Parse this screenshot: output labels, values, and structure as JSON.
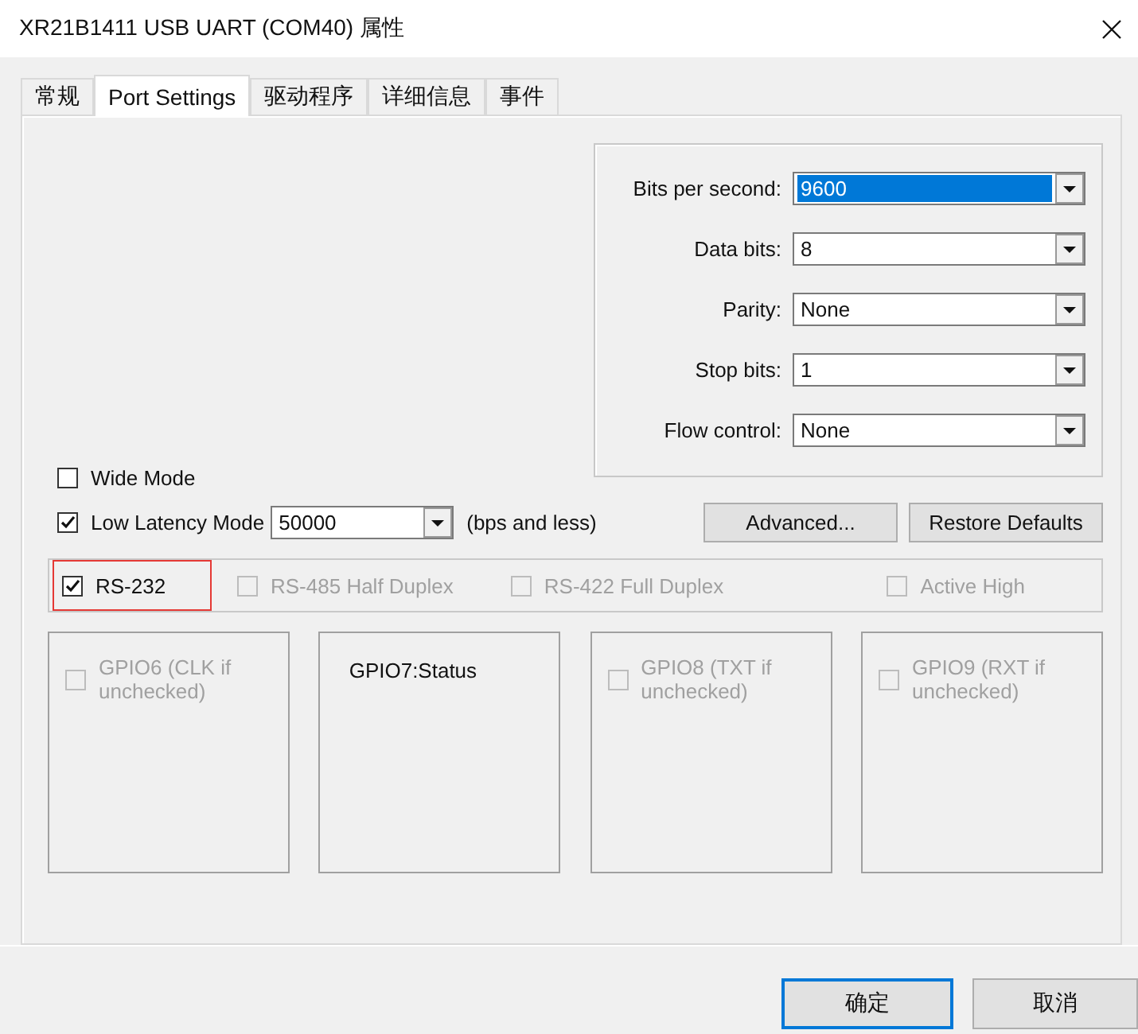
{
  "window": {
    "title": "XR21B1411 USB UART (COM40) 属性"
  },
  "tabs": [
    {
      "label": "常规",
      "selected": false
    },
    {
      "label": "Port Settings",
      "selected": true
    },
    {
      "label": "驱动程序",
      "selected": false
    },
    {
      "label": "详细信息",
      "selected": false
    },
    {
      "label": "事件",
      "selected": false
    }
  ],
  "port_settings": [
    {
      "label": "Bits per second:",
      "value": "9600",
      "highlighted": true
    },
    {
      "label": "Data bits:",
      "value": "8",
      "highlighted": false
    },
    {
      "label": "Parity:",
      "value": "None",
      "highlighted": false
    },
    {
      "label": "Stop bits:",
      "value": "1",
      "highlighted": false
    },
    {
      "label": "Flow control:",
      "value": "None",
      "highlighted": false
    }
  ],
  "wide_mode": {
    "label": "Wide Mode",
    "checked": false
  },
  "low_latency": {
    "label": "Low Latency Mode",
    "checked": true,
    "value": "50000",
    "suffix": "(bps and less)"
  },
  "actions": [
    "Advanced...",
    "Restore Defaults"
  ],
  "modes": [
    {
      "label": "RS-232",
      "checked": true,
      "disabled": false,
      "highlighted": true
    },
    {
      "label": "RS-485 Half Duplex",
      "checked": false,
      "disabled": true,
      "highlighted": false
    },
    {
      "label": "RS-422 Full Duplex",
      "checked": false,
      "disabled": true,
      "highlighted": false
    },
    {
      "label": "Active High",
      "checked": false,
      "disabled": true,
      "highlighted": false
    }
  ],
  "gpio": [
    {
      "kind": "checkbox",
      "label": "GPIO6 (CLK if unchecked)",
      "checked": false,
      "disabled": true
    },
    {
      "kind": "status",
      "label": "GPIO7:Status"
    },
    {
      "kind": "checkbox",
      "label": "GPIO8 (TXT if unchecked)",
      "checked": false,
      "disabled": true
    },
    {
      "kind": "checkbox",
      "label": "GPIO9 (RXT if unchecked)",
      "checked": false,
      "disabled": true
    }
  ],
  "footer_buttons": [
    {
      "label": "确定",
      "default": true
    },
    {
      "label": "取消",
      "default": false
    }
  ]
}
